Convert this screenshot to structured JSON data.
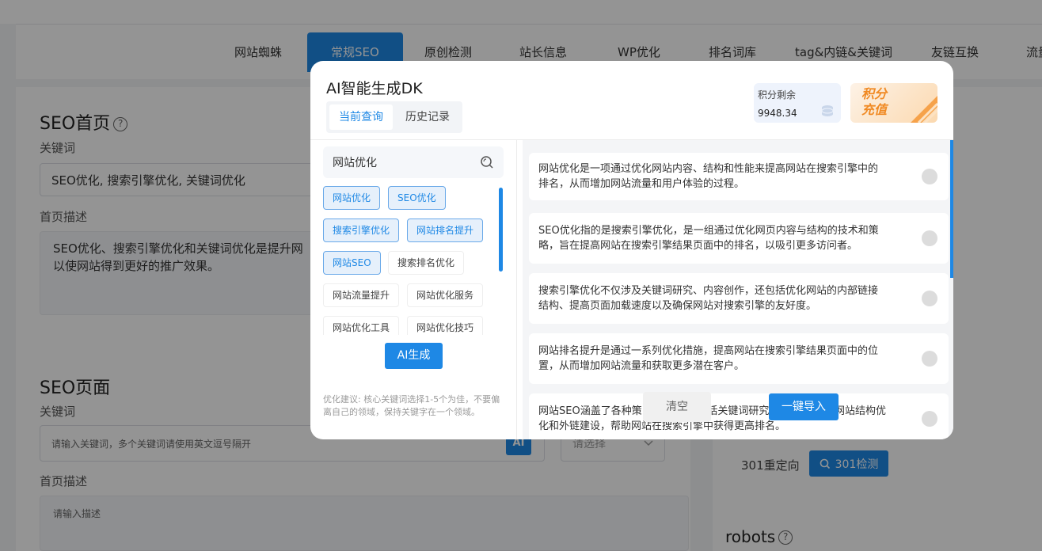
{
  "nav": {
    "tabs": [
      {
        "label": "网站蜘蛛"
      },
      {
        "label": "常规SEO"
      },
      {
        "label": "原创检测"
      },
      {
        "label": "站长信息"
      },
      {
        "label": "WP优化"
      },
      {
        "label": "排名词库"
      },
      {
        "label": "tag&内链&关键词"
      },
      {
        "label": "友链互换"
      },
      {
        "label": "流量"
      }
    ]
  },
  "seo_home": {
    "title": "SEO首页",
    "help_icon": "?",
    "keyword_label": "关键词",
    "keyword_value": "SEO优化, 搜索引擎优化, 关键词优化",
    "desc_label": "首页描述",
    "desc_value": "SEO优化、搜索引擎优化和关键词优化是提升网",
    "desc_value_line2": "以使网站得到更好的推广效果。"
  },
  "seo_page": {
    "title": "SEO页面",
    "keyword_label": "关键词",
    "keyword_placeholder": "请输入关键词，多个关键词请使用英文逗号隔开",
    "ai_badge": "AI",
    "select_placeholder": "请选择",
    "desc_label": "首页描述",
    "desc_placeholder": "请输入描述"
  },
  "right_panel": {
    "redirect_label": "301重定向",
    "check_button": "301检测",
    "robots_title": "robots",
    "help_icon": "?"
  },
  "modal": {
    "title": "AI智能生成DK",
    "tabs": [
      {
        "label": "当前查询"
      },
      {
        "label": "历史记录"
      }
    ],
    "points_label": "积分剩余",
    "points_value": "9948.34",
    "recharge_label": "积分充值",
    "recharge_line1": "积分",
    "recharge_line2": "充值",
    "search_value": "网站优化",
    "keywords": [
      {
        "label": "网站优化",
        "selected": true
      },
      {
        "label": "SEO优化",
        "selected": true
      },
      {
        "label": "搜索引擎优化",
        "selected": true
      },
      {
        "label": "网站排名提升",
        "selected": true
      },
      {
        "label": "网站SEO",
        "selected": true
      },
      {
        "label": "搜索排名优化",
        "selected": false
      },
      {
        "label": "网站流量提升",
        "selected": false
      },
      {
        "label": "网站优化服务",
        "selected": false
      },
      {
        "label": "网站优化工具",
        "selected": false
      },
      {
        "label": "网站优化技巧",
        "selected": false
      }
    ],
    "generate_button": "AI生成",
    "tip": "优化建议: 核心关键词选择1-5个为佳，不要偏离自己的领域，保持关键字在一个领域。",
    "results": [
      {
        "line1": "网站优化是一项通过优化网站内容、结构和性能来提高网站在搜索引擎中的",
        "line2": "排名，从而增加网站流量和用户体验的过程。"
      },
      {
        "line1": "SEO优化指的是搜索引擎优化，是一组通过优化网页内容与结构的技术和策",
        "line2": "略，旨在提高网站在搜索引擎结果页面中的排名，以吸引更多访问者。"
      },
      {
        "line1": "搜索引擎优化不仅涉及关键词研究、内容创作，还包括优化网站的内部链接",
        "line2": "结构、提高页面加载速度以及确保网站对搜索引擎的友好度。"
      },
      {
        "line1": "网站排名提升是通过一系列优化措施，提高网站在搜索引擎结果页面中的位",
        "line2": "置，从而增加网站流量和获取更多潜在客户。"
      },
      {
        "line1": "网站SEO涵盖了各种策                    括关键词研究                    网站结构优",
        "line2": "化和外链建设，帮助网站在搜索引擎中获得更高排名。"
      }
    ],
    "clear_button": "清空",
    "import_button": "一键导入"
  },
  "colors": {
    "primary": "#1e88e5",
    "overlay": "rgba(0,0,0,0.42)",
    "recharge_orange": "#f08a24"
  }
}
